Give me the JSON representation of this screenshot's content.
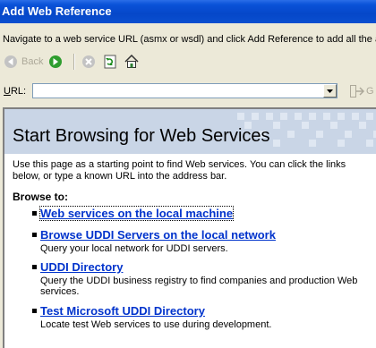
{
  "window": {
    "title": "Add Web Reference"
  },
  "instruction": "Navigate to a web service URL (asmx or wsdl) and click Add Reference to add all the av",
  "toolbar": {
    "back_label": "Back",
    "back_icon": "back-arrow-icon",
    "forward_icon": "forward-arrow-icon",
    "stop_icon": "stop-icon",
    "refresh_icon": "refresh-icon",
    "home_icon": "home-icon"
  },
  "address": {
    "label": "URL:",
    "value": "",
    "go_label": "G"
  },
  "page": {
    "title": "Start Browsing for Web Services",
    "intro": "Use this page as a starting point to find Web services. You can click the links below, or type a known URL into the address bar.",
    "browse_to": "Browse to:",
    "links": [
      {
        "label": "Web services on the local machine",
        "desc": ""
      },
      {
        "label": "Browse UDDI Servers on the local network",
        "desc": "Query your local network for UDDI servers."
      },
      {
        "label": "UDDI Directory",
        "desc": "Query the UDDI business registry to find companies and production Web services."
      },
      {
        "label": "Test Microsoft UDDI Directory",
        "desc": "Locate test Web services to use during development."
      }
    ]
  },
  "colors": {
    "title_bar": "#0a52d8",
    "banner": "#c9d5e6",
    "link": "#0033cc",
    "window_bg": "#ece9d8"
  }
}
